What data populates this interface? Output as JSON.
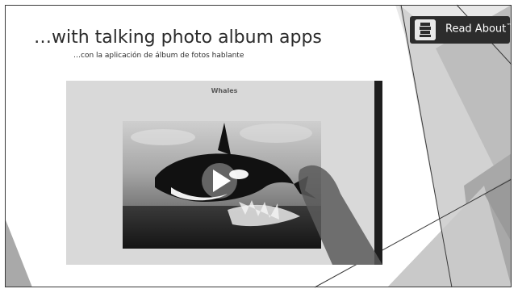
{
  "slide": {
    "title": "…with talking photo album apps",
    "subtitle": "…con la aplicación de álbum de fotos hablante"
  },
  "logo": {
    "text": "Read About",
    "mark": "™"
  },
  "video": {
    "caption": "Whales",
    "play_icon": "play-icon",
    "subject": "orca whale jumping from the sea"
  },
  "colors": {
    "slide_bg": "#ffffff",
    "accent_gray": "#9a9a9a",
    "logo_bg": "#2c2c2c",
    "frame_dark": "#3a3a3a"
  }
}
